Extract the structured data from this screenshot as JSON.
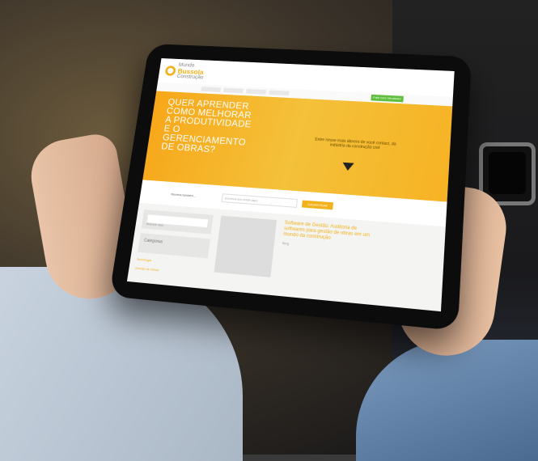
{
  "site": {
    "logo": {
      "line1": "Mundo",
      "line2": "Bussola",
      "line3": "Construção"
    },
    "hero": {
      "title": "QUER APRENDER COMO MELHORAR A PRODUTIVIDADE E O GERENCIAMENTO DE OBRAS?",
      "subtitle": "Entre nesse mais ábnero de você contact, da indústria da construção civil"
    },
    "subnav_cta": "Fale com Vendedor",
    "signup": {
      "label": "Receba também...",
      "placeholder": "Escreva seu email aqui",
      "button": "CADASTRAR"
    },
    "sidebar": {
      "search_placeholder": "Busque aqui",
      "category_label": "Categorias",
      "links": [
        "Tecnologia",
        "Gestão de Obras"
      ]
    },
    "post": {
      "title": "Software de Gestão: Auditoria de softwares para gestão de obras em um mundo da construção",
      "meta": "Blog",
      "excerpt": "..."
    }
  }
}
